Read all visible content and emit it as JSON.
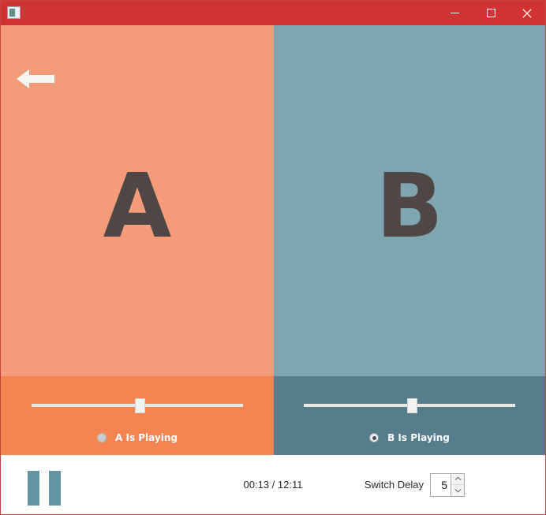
{
  "window": {
    "title": "",
    "icon": "app-window-icon",
    "accent_titlebar": "#d03432",
    "border_color": "#c9413f",
    "controls": {
      "minimize": "minimize-icon",
      "maximize": "maximize-icon",
      "close": "close-icon"
    }
  },
  "nav": {
    "back_arrow": "back-arrow-icon"
  },
  "panes": {
    "a": {
      "letter": "A",
      "bg": "#f49c79",
      "strip_bg": "#f48452",
      "slider": {
        "value": 51,
        "min": 0,
        "max": 100
      },
      "radio": {
        "label": "A Is Playing",
        "selected": false
      }
    },
    "b": {
      "letter": "B",
      "bg": "#7fa6b0",
      "strip_bg": "#557d8c",
      "slider": {
        "value": 51,
        "min": 0,
        "max": 100
      },
      "radio": {
        "label": "B Is Playing",
        "selected": true
      }
    }
  },
  "transport": {
    "pause_icon": "pause-icon",
    "time": "00:13 / 12:11",
    "elapsed": "00:13",
    "duration": "12:11",
    "switch_delay": {
      "label": "Switch Delay",
      "value": "5",
      "increment_icon": "chevron-up-icon",
      "decrement_icon": "chevron-down-icon"
    }
  }
}
